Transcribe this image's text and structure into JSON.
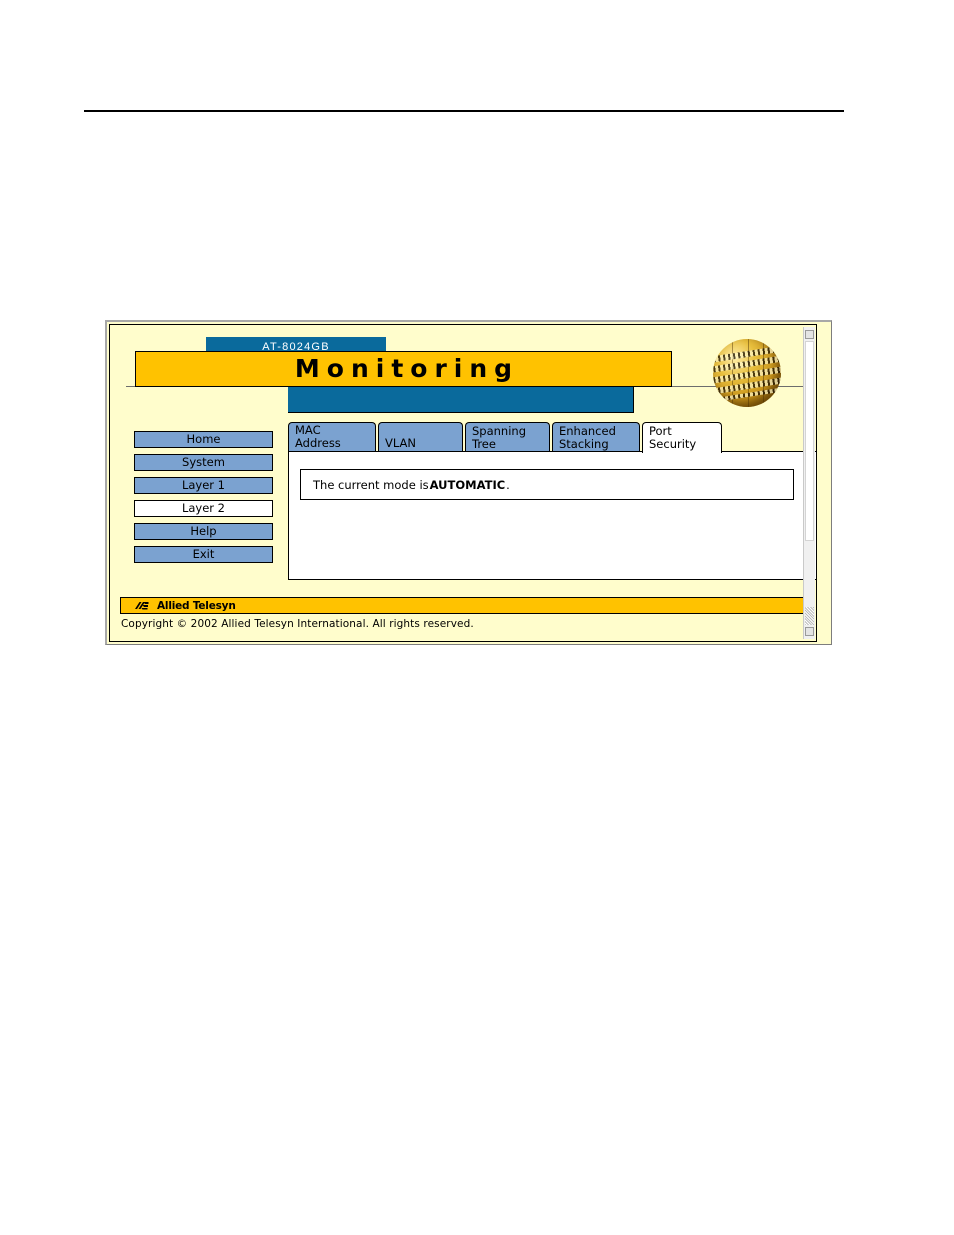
{
  "document": {
    "header_rule": true
  },
  "app": {
    "device_name": "AT-8024GB",
    "page_title": "Monitoring",
    "globe_icon": "globe-icon",
    "colors": {
      "background": "#FFFDCC",
      "title_bar": "#FFC200",
      "device_tab": "#0A6A9C",
      "tab_inactive": "#7BA2D0",
      "tab_active": "#FFFFFF",
      "border": "#000000"
    }
  },
  "nav": {
    "items": [
      {
        "label": "Home",
        "selected": false
      },
      {
        "label": "System",
        "selected": false
      },
      {
        "label": "Layer 1",
        "selected": false
      },
      {
        "label": "Layer 2",
        "selected": true
      },
      {
        "label": "Help",
        "selected": false
      },
      {
        "label": "Exit",
        "selected": false
      }
    ]
  },
  "tabs": {
    "items": [
      {
        "label": "MAC Address",
        "active": false
      },
      {
        "label": "VLAN",
        "active": false
      },
      {
        "label": "Spanning\nTree",
        "active": false
      },
      {
        "label": "Enhanced\nStacking",
        "active": false
      },
      {
        "label": "Port\nSecurity",
        "active": true
      }
    ]
  },
  "content": {
    "status_prefix": "The current mode is ",
    "mode_value": "AUTOMATIC",
    "status_suffix": "."
  },
  "footer": {
    "logo_text": "Allied Telesyn",
    "copyright": "Copyright © 2002 Allied Telesyn International. All rights reserved."
  }
}
